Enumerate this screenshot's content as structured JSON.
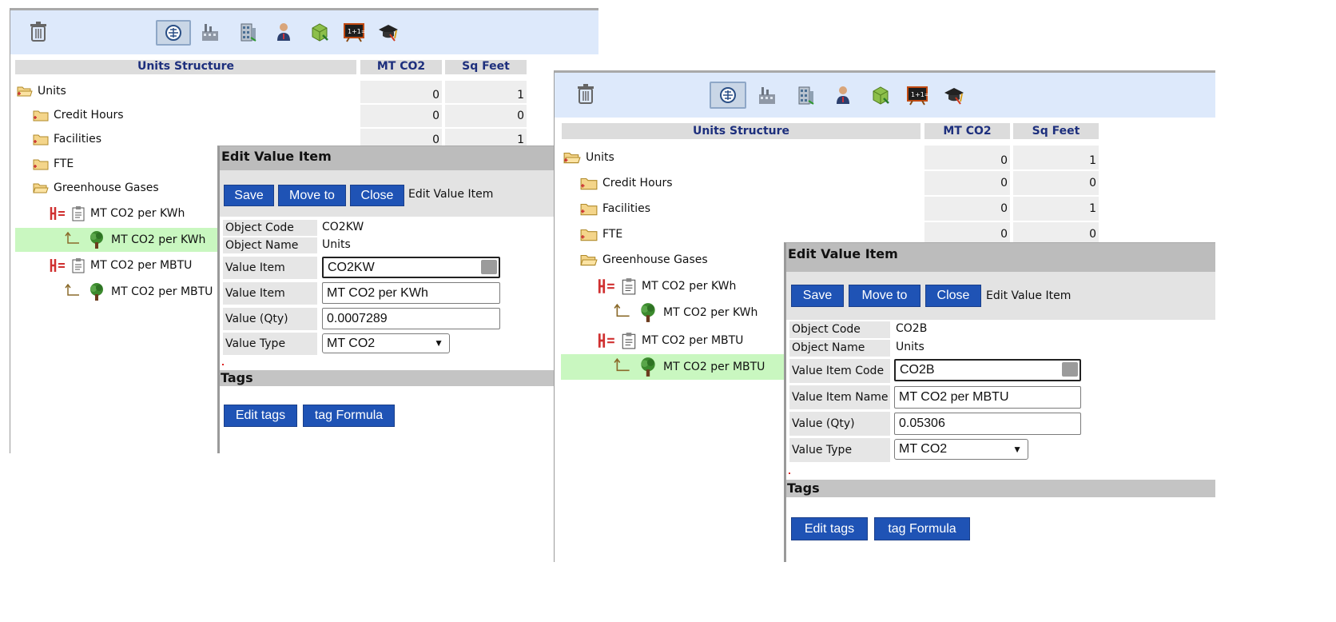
{
  "panels": [
    {
      "tree_header": "Units Structure",
      "col_headers": [
        "MT CO2",
        "Sq Feet"
      ],
      "tree": [
        {
          "label": "Units",
          "icon": "folder-open-icon"
        },
        {
          "label": "Credit Hours",
          "icon": "folder-icon"
        },
        {
          "label": "Facilities",
          "icon": "folder-icon"
        },
        {
          "label": "FTE",
          "icon": "folder-icon"
        },
        {
          "label": "Greenhouse Gases",
          "icon": "folder-open-icon"
        },
        {
          "label": "MT CO2 per KWh",
          "icon": "clipboard-icon"
        },
        {
          "label": "MT CO2 per KWh",
          "icon": "tree-icon"
        },
        {
          "label": "MT CO2 per MBTU",
          "icon": "clipboard-icon"
        },
        {
          "label": "MT CO2 per MBTU",
          "icon": "tree-icon"
        }
      ],
      "rows": [
        [
          "0",
          "1"
        ],
        [
          "0",
          "0"
        ],
        [
          "0",
          "1"
        ]
      ],
      "dialog": {
        "title": "Edit Value Item",
        "buttons": {
          "save": "Save",
          "move": "Move to",
          "close": "Close"
        },
        "bar_label": "Edit Value Item",
        "fields": {
          "object_code_label": "Object Code",
          "object_code": "CO2KW",
          "object_name_label": "Object Name",
          "object_name": "Units",
          "value_item_code_label": "Value Item Code",
          "value_item_code": "CO2KW",
          "value_item_name_label": "Value Item Name",
          "value_item_name": "MT CO2 per KWh",
          "value_qty_label": "Value (Qty)",
          "value_qty": "0.0007289",
          "value_type_label": "Value Type",
          "value_type": "MT CO2"
        },
        "tags_label": "Tags",
        "tag_buttons": {
          "edit": "Edit tags",
          "formula": "tag Formula"
        }
      }
    },
    {
      "tree_header": "Units Structure",
      "col_headers": [
        "MT CO2",
        "Sq Feet"
      ],
      "tree": [
        {
          "label": "Units",
          "icon": "folder-open-icon"
        },
        {
          "label": "Credit Hours",
          "icon": "folder-icon"
        },
        {
          "label": "Facilities",
          "icon": "folder-icon"
        },
        {
          "label": "FTE",
          "icon": "folder-icon"
        },
        {
          "label": "Greenhouse Gases",
          "icon": "folder-open-icon"
        },
        {
          "label": "MT CO2 per KWh",
          "icon": "clipboard-icon"
        },
        {
          "label": "MT CO2 per KWh",
          "icon": "tree-icon"
        },
        {
          "label": "MT CO2 per MBTU",
          "icon": "clipboard-icon"
        },
        {
          "label": "MT CO2 per MBTU",
          "icon": "tree-icon"
        }
      ],
      "rows": [
        [
          "0",
          "1"
        ],
        [
          "0",
          "0"
        ],
        [
          "0",
          "1"
        ],
        [
          "0",
          "0"
        ]
      ],
      "dialog": {
        "title": "Edit Value Item",
        "buttons": {
          "save": "Save",
          "move": "Move to",
          "close": "Close"
        },
        "bar_label": "Edit Value Item",
        "fields": {
          "object_code_label": "Object Code",
          "object_code": "CO2B",
          "object_name_label": "Object Name",
          "object_name": "Units",
          "value_item_code_label": "Value Item Code",
          "value_item_code": "CO2B",
          "value_item_name_label": "Value Item Name",
          "value_item_name": "MT CO2 per MBTU",
          "value_qty_label": "Value (Qty)",
          "value_qty": "0.05306",
          "value_type_label": "Value Type",
          "value_type": "MT CO2"
        },
        "tags_label": "Tags",
        "tag_buttons": {
          "edit": "Edit tags",
          "formula": "tag Formula"
        }
      }
    }
  ],
  "toolbar_icons": [
    "trash-icon",
    "tree-view-icon",
    "factory-icon",
    "building-icon",
    "person-icon",
    "box-icon",
    "blackboard-icon",
    "graduation-cap-icon"
  ],
  "colors": {
    "toolbar_bg": "#dde9fb",
    "button_blue": "#1f53b5",
    "selected_row": "#c9f7c0",
    "header_text": "#1d2f7d"
  }
}
